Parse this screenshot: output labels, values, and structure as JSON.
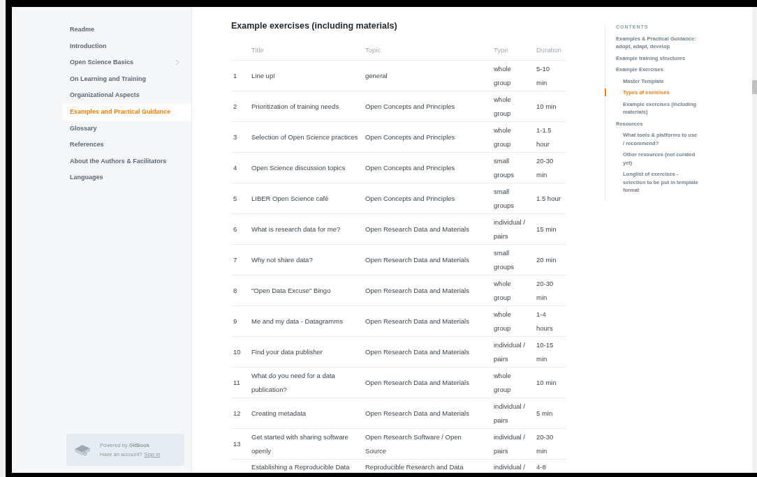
{
  "sidebar": {
    "items": [
      {
        "label": "Readme",
        "selected": false,
        "expandable": false
      },
      {
        "label": "Introduction",
        "selected": false,
        "expandable": false
      },
      {
        "label": "Open Science Basics",
        "selected": false,
        "expandable": true
      },
      {
        "label": "On Learning and Training",
        "selected": false,
        "expandable": false
      },
      {
        "label": "Organizational Aspects",
        "selected": false,
        "expandable": false
      },
      {
        "label": "Examples and Practical Guidance",
        "selected": true,
        "expandable": false
      },
      {
        "label": "Glossary",
        "selected": false,
        "expandable": false
      },
      {
        "label": "References",
        "selected": false,
        "expandable": false
      },
      {
        "label": "About the Authors & Facilitators",
        "selected": false,
        "expandable": false
      },
      {
        "label": "Languages",
        "selected": false,
        "expandable": false
      }
    ],
    "footer": {
      "powered": "Powered by **GitBook**",
      "account": "Have an account?",
      "link": "Sign in"
    }
  },
  "heading": "Example exercises (including materials)",
  "table": {
    "columns": [
      "",
      "Title",
      "Topic",
      "Type",
      "Duration"
    ],
    "rows": [
      [
        "1",
        "Line up!",
        "general",
        "whole group",
        "5-10 min"
      ],
      [
        "2",
        "Prioritization of training needs",
        "Open Concepts and Principles",
        "whole group",
        "10 min"
      ],
      [
        "3",
        "Selection of Open Science practices",
        "Open Concepts and Principles",
        "whole group",
        "1-1.5 hour"
      ],
      [
        "4",
        "Open Science discussion topics",
        "Open Concepts and Principles",
        "small groups",
        "20-30 min"
      ],
      [
        "5",
        "LIBER Open Science café",
        "Open Concepts and Principles",
        "small groups",
        "1.5 hour"
      ],
      [
        "6",
        "What is research data for me?",
        "Open Research Data and Materials",
        "individual / pairs",
        "15 min"
      ],
      [
        "7",
        "Why not share data?",
        "Open Research Data and Materials",
        "small groups",
        "20 min"
      ],
      [
        "8",
        "\"Open Data Excuse\" Bingo",
        "Open Research Data and Materials",
        "whole group",
        "20-30 min"
      ],
      [
        "9",
        "Me and my data - Datagramms",
        "Open Research Data and Materials",
        "whole group",
        "1-4 hours"
      ],
      [
        "10",
        "Find your data publisher",
        "Open Research Data and Materials",
        "individual / pairs",
        "10-15 min"
      ],
      [
        "11",
        "What do you need for a data publication?",
        "Open Research Data and Materials",
        "whole group",
        "10 min"
      ],
      [
        "12",
        "Creating metadata",
        "Open Research Data and Materials",
        "individual / pairs",
        "5 min"
      ],
      [
        "13",
        "Get started with sharing software openly",
        "Open Research Software / Open Source",
        "individual / pairs",
        "20-30 min"
      ],
      [
        "",
        "Establishing a Reproducible Data",
        "Reproducible Research and Data",
        "individual /",
        "4-8"
      ]
    ]
  },
  "contents": {
    "label": "CONTENTS",
    "items": [
      {
        "label": "Examples & Practical Guidance: adopt, adapt, develop",
        "selected": false
      },
      {
        "label": "Example training structures",
        "selected": false
      },
      {
        "label": "Example Exercises",
        "selected": false,
        "children": [
          {
            "label": "Master Template",
            "selected": false
          },
          {
            "label": "Types of exercises",
            "selected": true
          },
          {
            "label": "Example exercises (including materials)",
            "selected": false
          }
        ]
      },
      {
        "label": "Resources",
        "selected": false,
        "children": [
          {
            "label": "What tools & platforms to use / recommend?",
            "selected": false
          },
          {
            "label": "Other resources (not curated yet)",
            "selected": false
          },
          {
            "label": "Longlist of exercises - selection to be put in template format",
            "selected": false
          }
        ]
      }
    ]
  }
}
